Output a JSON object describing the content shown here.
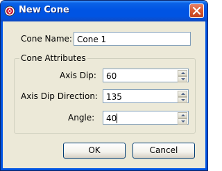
{
  "window": {
    "title": "New Cone"
  },
  "form": {
    "cone_name_label": "Cone Name:",
    "cone_name_value": "Cone 1"
  },
  "attributes": {
    "group_label": "Cone Attributes",
    "axis_dip_label": "Axis Dip:",
    "axis_dip_value": "60",
    "axis_dip_direction_label": "Axis Dip Direction:",
    "axis_dip_direction_value": "135",
    "angle_label": "Angle:",
    "angle_value": "40"
  },
  "buttons": {
    "ok": "OK",
    "cancel": "Cancel"
  },
  "icons": {
    "app": "app-icon",
    "close": "close-icon",
    "spin_up": "spin-up-icon",
    "spin_down": "spin-down-icon"
  },
  "colors": {
    "titlebar": "#0054e3",
    "dialog_bg": "#ece9d8",
    "close_button": "#d9582f"
  }
}
